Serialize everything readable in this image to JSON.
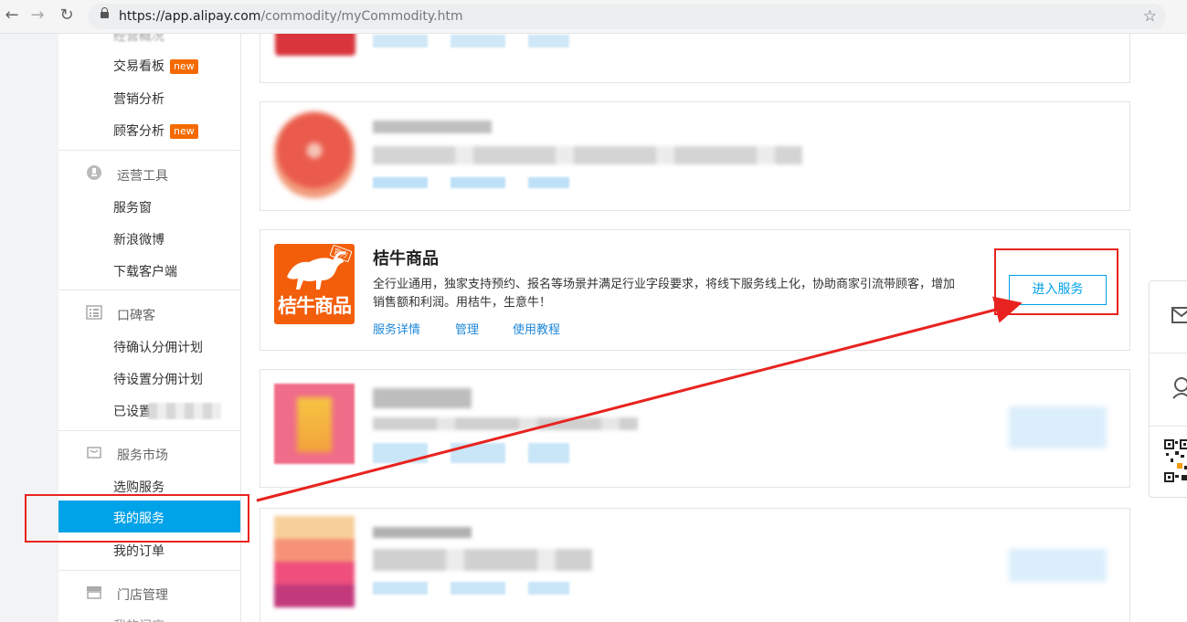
{
  "browser": {
    "url_host": "https://app.alipay.com",
    "url_path": "/commodity/myCommodity.htm",
    "back_icon": "back-arrow-icon",
    "forward_icon": "forward-arrow-icon",
    "reload_icon": "reload-icon",
    "bookmark_icon": "star-icon"
  },
  "sidebar": {
    "top_items": [
      {
        "label": "交易看板",
        "badge": "new"
      },
      {
        "label": "营销分析",
        "badge": ""
      },
      {
        "label": "顾客分析",
        "badge": "new"
      }
    ],
    "sections": [
      {
        "title": "运营工具",
        "icon": "tool-icon",
        "items": [
          "服务窗",
          "新浪微博",
          "下载客户端"
        ]
      },
      {
        "title": "口碑客",
        "icon": "list-icon",
        "items": [
          "待确认分佣计划",
          "待设置分佣计划",
          "已设置分"
        ]
      },
      {
        "title": "服务市场",
        "icon": "bag-icon",
        "items": [
          "选购服务",
          "我的服务",
          "我的订单"
        ]
      },
      {
        "title": "门店管理",
        "icon": "store-icon",
        "items": []
      }
    ],
    "active_item": "我的服务",
    "accent": "#00a2e8"
  },
  "featured": {
    "title": "桔牛商品",
    "description": "全行业通用，独家支持预约、报名等场景并满足行业字段要求，将线下服务线上化，协助商家引流带顾客，增加销售额和利润。用桔牛，生意牛！",
    "links": [
      "服务详情",
      "管理",
      "使用教程"
    ],
    "enter_button": "进入服务",
    "logo_text": "桔牛商品",
    "logo_tag": "官方",
    "logo_color": "#f35e0b"
  },
  "annotation_color": "#e8231f"
}
